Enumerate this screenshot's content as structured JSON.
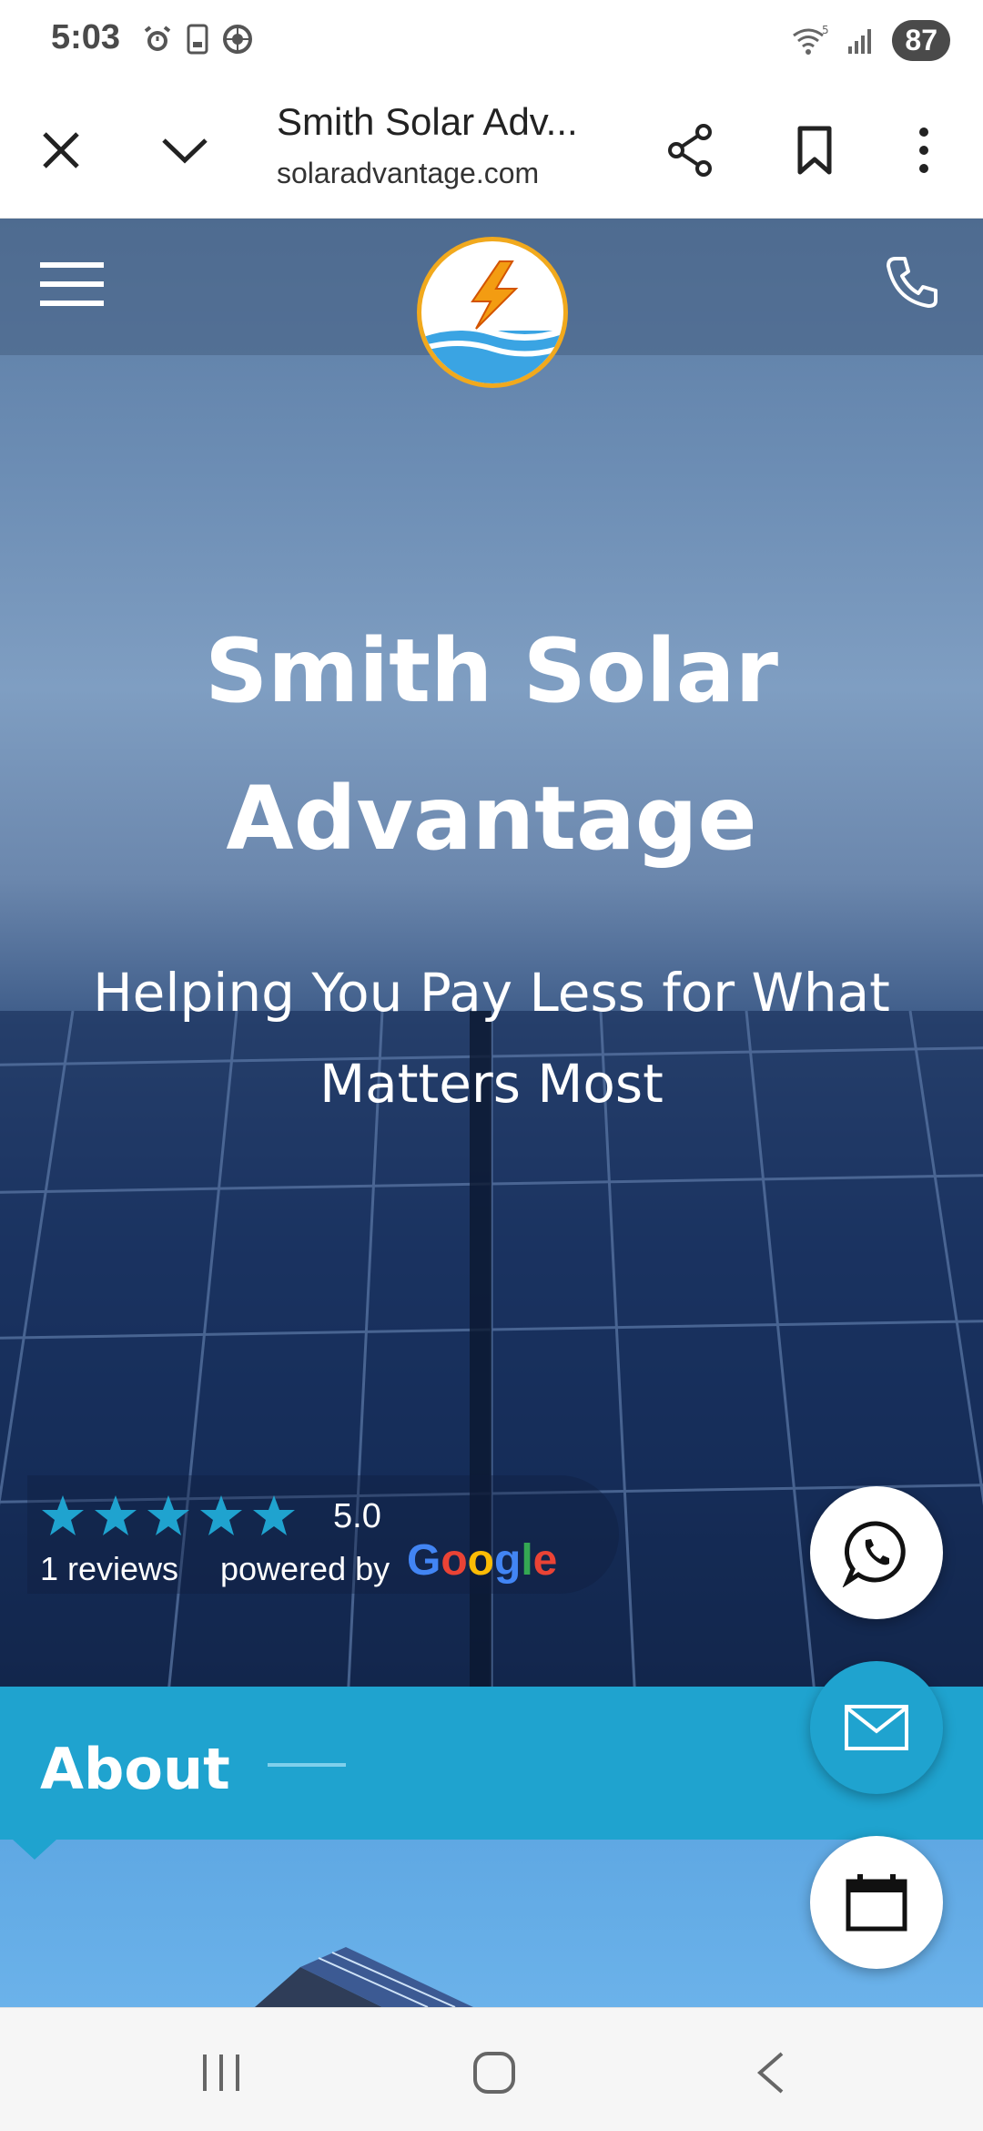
{
  "status_bar": {
    "time": "5:03",
    "battery": "87",
    "icons": [
      "alarm-icon",
      "phone-card-icon",
      "settings-wheel-icon",
      "wifi-icon",
      "signal-icon"
    ]
  },
  "browser": {
    "page_title": "Smith Solar Adv...",
    "url": "solaradvantage.com",
    "icons": [
      "close-icon",
      "chevron-down-icon",
      "share-icon",
      "bookmark-icon",
      "more-vert-icon"
    ]
  },
  "hero": {
    "title": "Smith Solar Advantage",
    "subtitle": "Helping You Pay Less for What Matters Most"
  },
  "reviews": {
    "stars": 5,
    "rating": "5.0",
    "count_text": "1 reviews",
    "powered_by": "powered by",
    "google": [
      "G",
      "o",
      "o",
      "g",
      "l",
      "e"
    ],
    "google_colors": [
      "#4285F4",
      "#EA4335",
      "#FBBC05",
      "#4285F4",
      "#34A853",
      "#EA4335"
    ],
    "star_color": "#1fa3cf"
  },
  "about": {
    "title": "About"
  },
  "colors": {
    "accent": "#1fa3cf",
    "logo_ring": "#f1a91d"
  },
  "fabs": [
    "whatsapp-icon",
    "email-icon",
    "calendar-icon"
  ],
  "system_nav": [
    "recents-icon",
    "home-icon",
    "back-icon"
  ]
}
